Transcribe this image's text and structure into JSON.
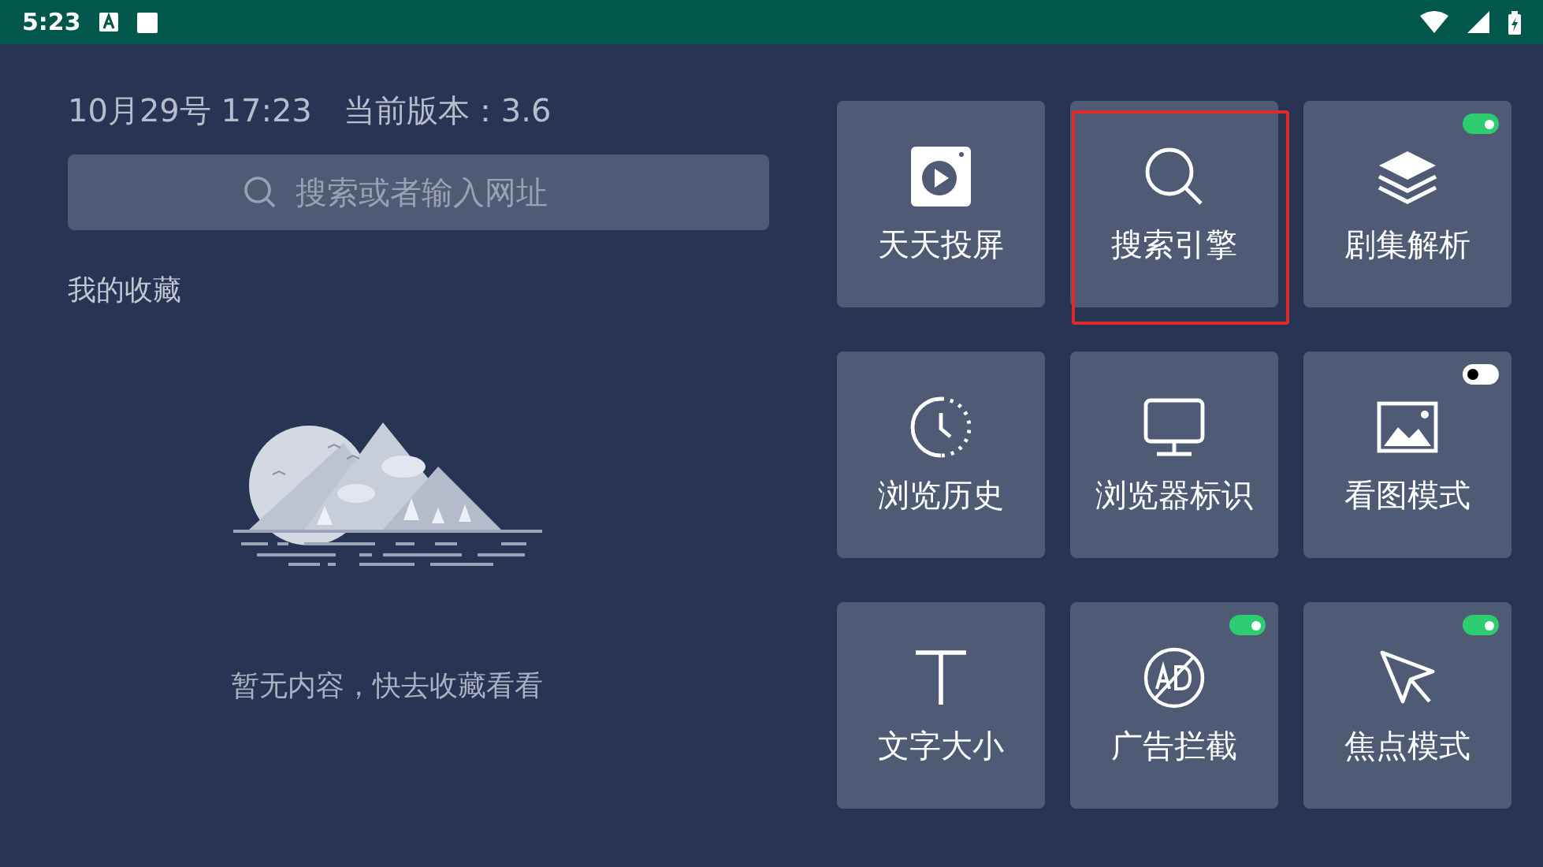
{
  "status_bar": {
    "time": "5:23"
  },
  "header": {
    "datetime": "10月29号 17:23",
    "version": "当前版本：3.6"
  },
  "search": {
    "placeholder": "搜索或者输入网址"
  },
  "favorites": {
    "title": "我的收藏",
    "empty_text": "暂无内容，快去收藏看看"
  },
  "tiles": [
    {
      "label": "天天投屏",
      "highlighted": false
    },
    {
      "label": "搜索引擎",
      "highlighted": true
    },
    {
      "label": "剧集解析",
      "highlighted": false,
      "on": true
    },
    {
      "label": "浏览历史",
      "highlighted": false
    },
    {
      "label": "浏览器标识",
      "highlighted": false
    },
    {
      "label": "看图模式",
      "highlighted": false,
      "on": false
    },
    {
      "label": "文字大小",
      "highlighted": false
    },
    {
      "label": "广告拦截",
      "highlighted": false,
      "on": true
    },
    {
      "label": "焦点模式",
      "highlighted": false,
      "on": true
    }
  ]
}
